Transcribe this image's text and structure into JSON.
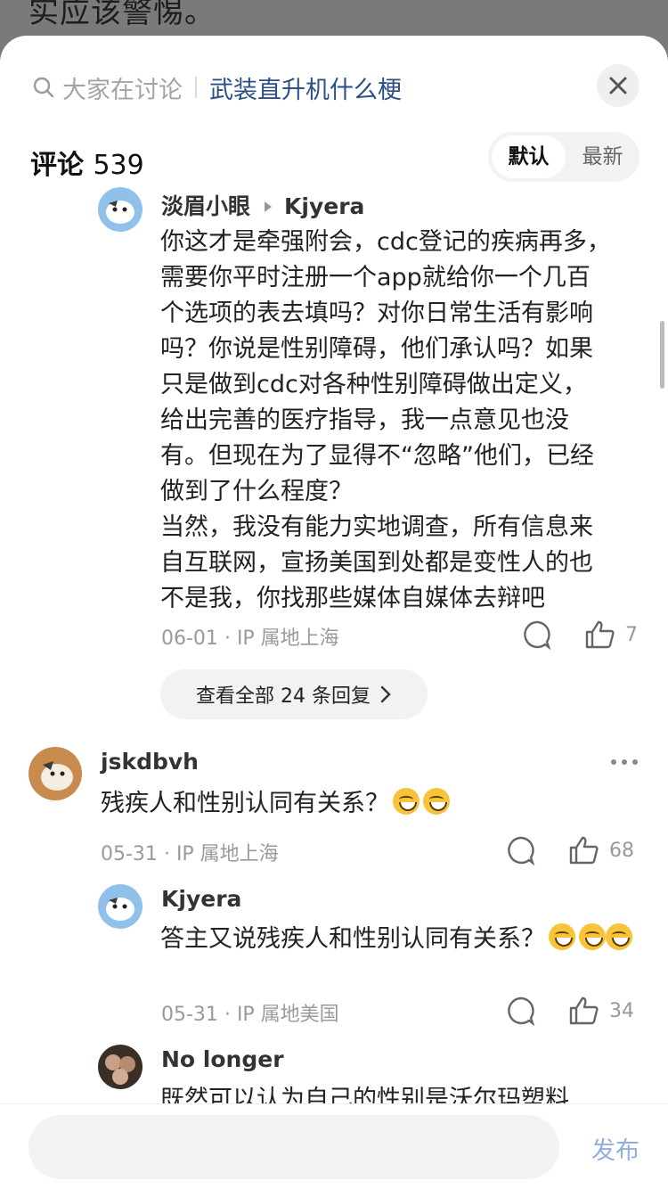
{
  "background_text": "实应该警惕。",
  "topbar": {
    "hint": "大家在讨论",
    "topic": "武装直升机什么梗"
  },
  "header": {
    "label": "评论",
    "count": "539"
  },
  "sort": {
    "default": "默认",
    "latest": "最新"
  },
  "comments": [
    {
      "user": "淡眉小眼",
      "reply_to": "Kjyera",
      "lines": [
        "你这才是牵强附会，cdc登记的疾病再多，",
        "需要你平时注册一个app就给你一个几百",
        "个选项的表去填吗？对你日常生活有影响",
        "吗？你说是性别障碍，他们承认吗？如果",
        "只是做到cdc对各种性别障碍做出定义，",
        "给出完善的医疗指导，我一点意见也没",
        "有。但现在为了显得不“忽略”他们，已经",
        "做到了什么程度？",
        "当然，我没有能力实地调查，所有信息来",
        "自互联网，宣扬美国到处都是变性人的也",
        "不是我，你找那些媒体自媒体去辩吧"
      ],
      "date": "06-01",
      "ip": "IP 属地上海",
      "likes": "7"
    },
    {
      "user": "jskdbvh",
      "text": "残疾人和性别认同有关系？",
      "date": "05-31",
      "ip": "IP 属地上海",
      "likes": "68"
    },
    {
      "user": "Kjyera",
      "text": "答主又说残疾人和性别认同有关系？",
      "date": "05-31",
      "ip": "IP 属地美国",
      "likes": "34"
    },
    {
      "user": "No longer",
      "text": "既然可以认为自己的性别是沃尔玛塑料"
    }
  ],
  "view_replies": "查看全部 24 条回复",
  "separator": "·",
  "publish": "发布",
  "colors": {
    "accent": "#2b4f86",
    "publish": "#8fb0de"
  },
  "icons": [
    "search-icon",
    "close-icon",
    "comment-icon",
    "like-icon",
    "chevron-right-icon",
    "more-icon",
    "sweat-smile-emoji"
  ]
}
